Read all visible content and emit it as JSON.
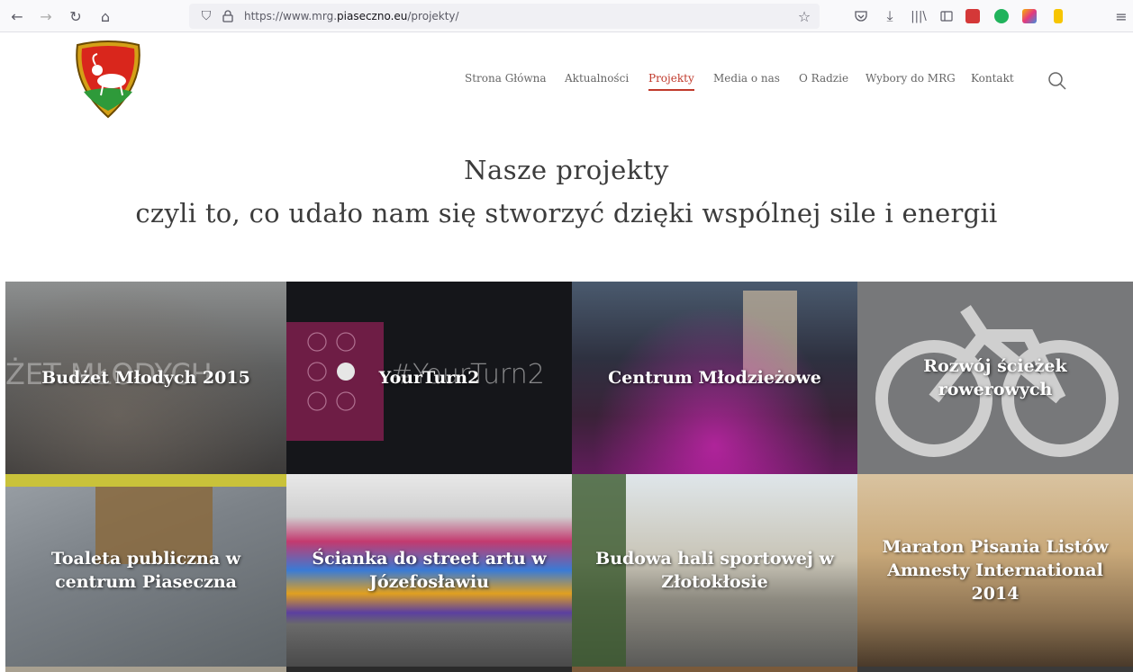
{
  "browser": {
    "url_prefix": "https://www.mrg.",
    "url_domain": "piaseczno.eu",
    "url_suffix": "/projekty/",
    "icons": [
      "back-icon",
      "forward-icon",
      "reload-icon",
      "home-icon",
      "shield-icon",
      "lock-icon",
      "bookmark-star-icon",
      "pocket-icon",
      "download-icon",
      "library-icon",
      "sidebar-icon",
      "extension-icons",
      "menu-icon"
    ]
  },
  "nav": {
    "items": [
      "Strona Główna",
      "Aktualności",
      "Projekty",
      "Media o nas",
      "O Radzie",
      "Wybory do MRG",
      "Kontakt"
    ],
    "active": "Projekty"
  },
  "heading": {
    "title": "Nasze projekty",
    "subtitle": "czyli to, co udało nam się stworzyć dzięki wspólnej sile i energii"
  },
  "projects": [
    {
      "label": "Budżet Młodych 2015"
    },
    {
      "label": "YourTurn2"
    },
    {
      "label": "Centrum Młodzieżowe"
    },
    {
      "label": "Rozwój ścieżek rowerowych"
    },
    {
      "label": "Toaleta publiczna w centrum Piaseczna"
    },
    {
      "label": "Ścianka do street artu w Józefosławiu"
    },
    {
      "label": "Budowa hali sportowej w Złotokłosie"
    },
    {
      "label": "Maraton Pisania Listów Amnesty International 2014"
    }
  ],
  "tile_text": {
    "yourturn_bg": "#YourTurn2",
    "budzet_bg": "ŻET MŁODYCH"
  },
  "colors": {
    "nav_active": "#c0392b",
    "heading": "#3c3c3c"
  }
}
